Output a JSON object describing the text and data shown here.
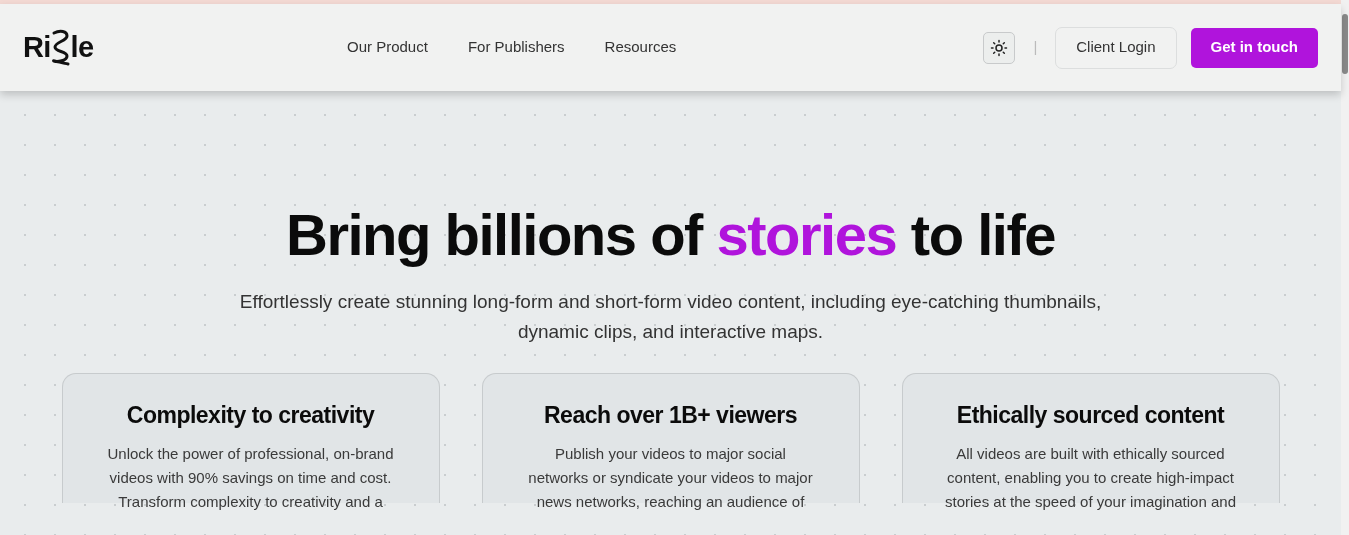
{
  "header": {
    "logo": {
      "before": "Ri",
      "after": "le"
    },
    "nav": [
      "Our Product",
      "For Publishers",
      "Resources"
    ],
    "separator": "|",
    "login_button": "Client Login",
    "cta_button": "Get in touch"
  },
  "hero": {
    "title": [
      {
        "text": "Bring billions of ",
        "highlighted": false
      },
      {
        "text": "stories",
        "highlighted": true
      },
      {
        "text": " to life",
        "highlighted": false
      }
    ],
    "subtitle": "Effortlessly create stunning long-form and short-form video content, including eye-catching thumbnails, dynamic clips, and interactive maps."
  },
  "cards": [
    {
      "title": "Complexity to creativity",
      "lines": [
        "Unlock the power of professional, on-brand",
        "videos with 90% savings on time and cost.",
        "Transform complexity to creativity and a"
      ]
    },
    {
      "title": "Reach over 1B+ viewers",
      "lines": [
        "Publish your videos to major social",
        "networks or syndicate your videos to major",
        "news networks, reaching an audience of"
      ]
    },
    {
      "title": "Ethically sourced content",
      "lines": [
        "All videos are built with ethically sourced",
        "content, enabling you to create high-impact",
        "stories at the speed of your imagination and"
      ]
    }
  ]
}
